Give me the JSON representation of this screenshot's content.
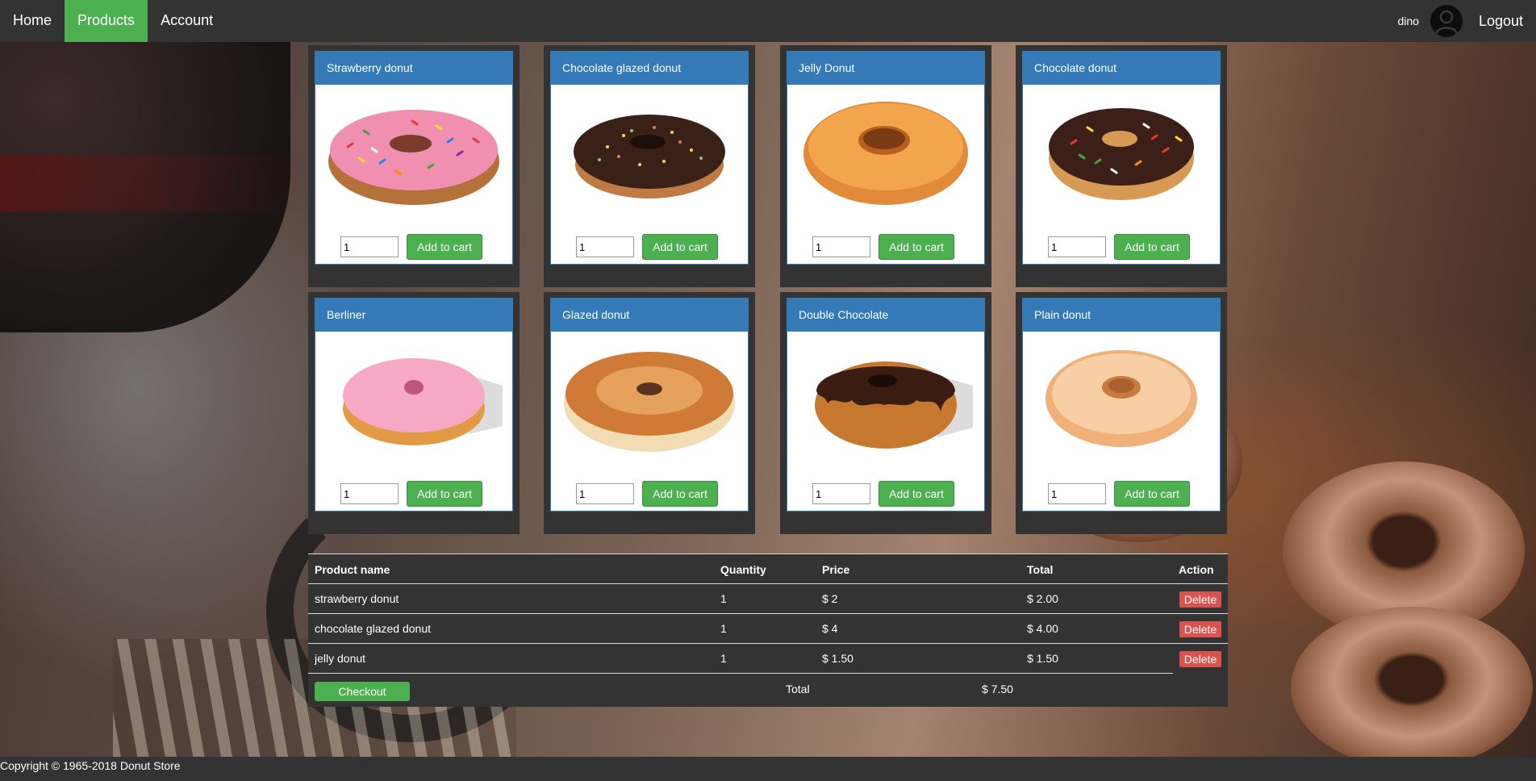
{
  "nav": {
    "items": [
      {
        "label": "Home",
        "active": false
      },
      {
        "label": "Products",
        "active": true
      },
      {
        "label": "Account",
        "active": false
      }
    ],
    "username": "dino",
    "logout_label": "Logout"
  },
  "products": [
    {
      "name": "Strawberry donut",
      "qty": "1",
      "button": "Add to cart",
      "icon": "strawberry-donut-image"
    },
    {
      "name": "Chocolate glazed donut",
      "qty": "1",
      "button": "Add to cart",
      "icon": "chocolate-glazed-donut-image"
    },
    {
      "name": "Jelly Donut",
      "qty": "1",
      "button": "Add to cart",
      "icon": "jelly-donut-image"
    },
    {
      "name": "Chocolate donut",
      "qty": "1",
      "button": "Add to cart",
      "icon": "chocolate-donut-image"
    },
    {
      "name": "Berliner",
      "qty": "1",
      "button": "Add to cart",
      "icon": "berliner-image"
    },
    {
      "name": "Glazed donut",
      "qty": "1",
      "button": "Add to cart",
      "icon": "glazed-donut-image"
    },
    {
      "name": "Double Chocolate",
      "qty": "1",
      "button": "Add to cart",
      "icon": "double-chocolate-donut-image"
    },
    {
      "name": "Plain donut",
      "qty": "1",
      "button": "Add to cart",
      "icon": "plain-donut-image"
    }
  ],
  "cart": {
    "headers": {
      "name": "Product name",
      "quantity": "Quantity",
      "price": "Price",
      "total": "Total",
      "action": "Action"
    },
    "rows": [
      {
        "name": "strawberry donut",
        "quantity": "1",
        "price": "$ 2",
        "total": "$ 2.00",
        "action": "Delete"
      },
      {
        "name": "chocolate glazed donut",
        "quantity": "1",
        "price": "$ 4",
        "total": "$ 4.00",
        "action": "Delete"
      },
      {
        "name": "jelly donut",
        "quantity": "1",
        "price": "$ 1.50",
        "total": "$ 1.50",
        "action": "Delete"
      }
    ],
    "checkout_label": "Checkout",
    "total_label": "Total",
    "total_value": "$ 7.50"
  },
  "footer": {
    "copyright": "Copyright © 1965-2018 Donut Store"
  },
  "colors": {
    "navbar": "#333333",
    "accent_green": "#4CAF50",
    "card_header_blue": "#337ab7",
    "delete_red": "#d9534f"
  }
}
